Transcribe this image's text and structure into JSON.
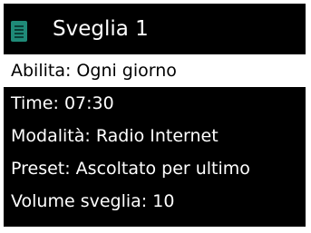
{
  "header": {
    "title": "Sveglia 1",
    "icon": "list-icon"
  },
  "menu": {
    "items": [
      {
        "label": "Abilita: Ogni giorno",
        "selected": true
      },
      {
        "label": "Time: 07:30",
        "selected": false
      },
      {
        "label": "Modalità: Radio Internet",
        "selected": false
      },
      {
        "label": "Preset: Ascoltato per ultimo",
        "selected": false
      },
      {
        "label": "Volume sveglia: 10",
        "selected": false
      }
    ]
  },
  "colors": {
    "background": "#000000",
    "text": "#ffffff",
    "selected_background": "#ffffff",
    "selected_text": "#000000",
    "icon": "#1f8a78"
  }
}
